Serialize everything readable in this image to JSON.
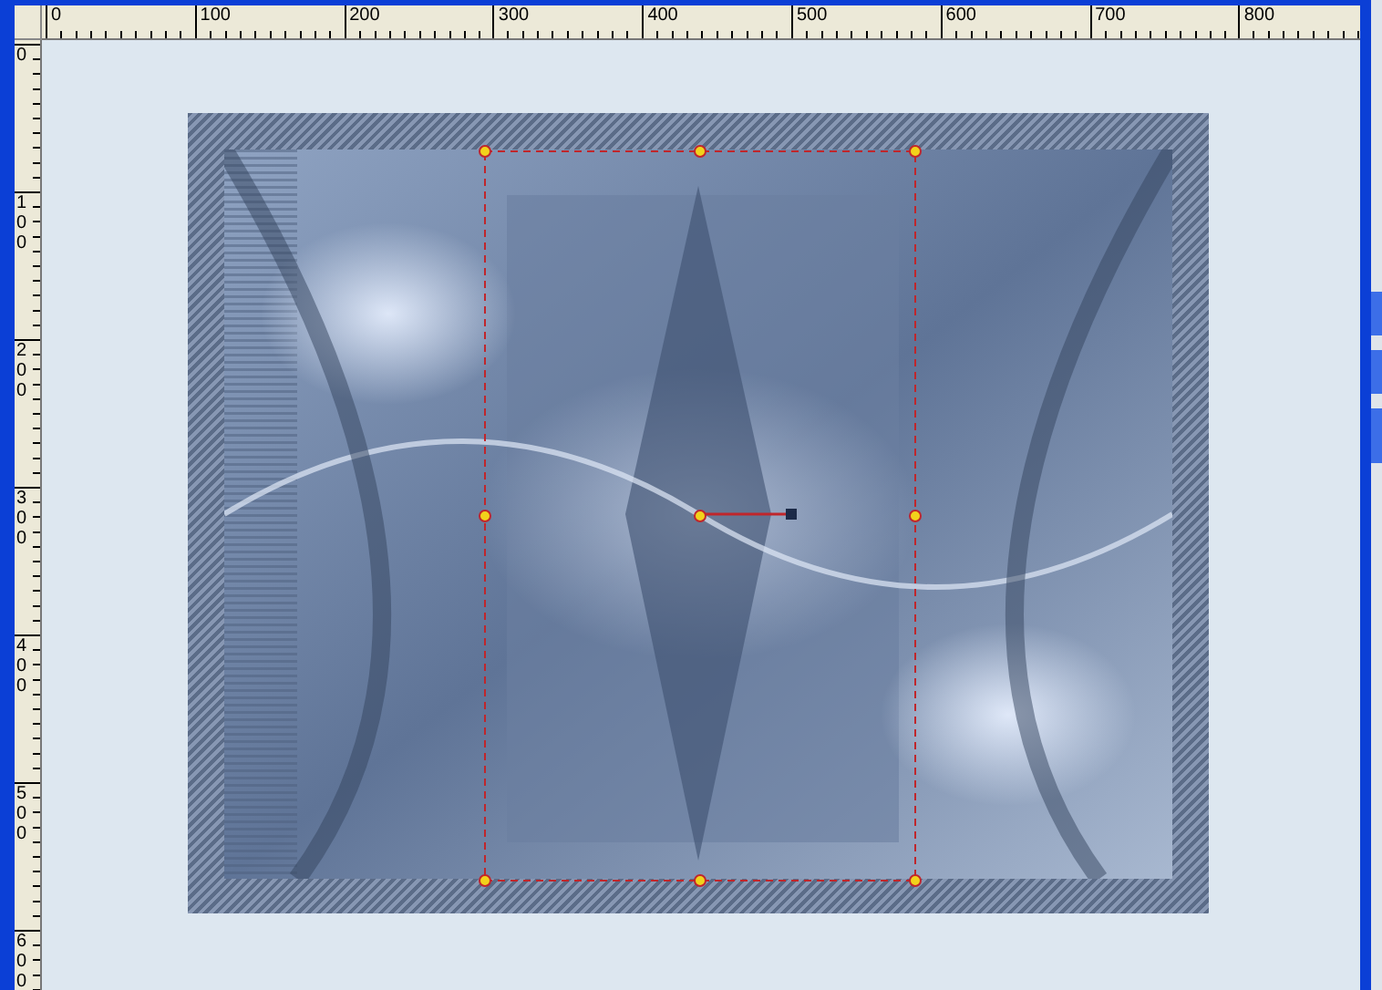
{
  "rulers": {
    "horizontal": [
      "0",
      "100",
      "200",
      "300",
      "400",
      "500",
      "600",
      "700",
      "800"
    ],
    "vertical": [
      "0",
      "100",
      "200",
      "300",
      "400",
      "500",
      "600"
    ]
  }
}
